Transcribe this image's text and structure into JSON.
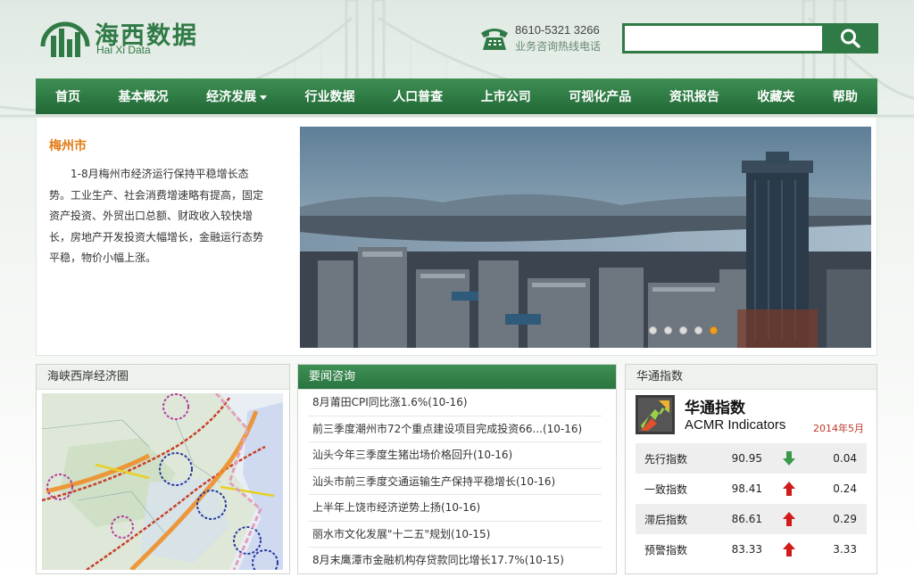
{
  "brand": {
    "name_cn": "海西数据",
    "name_en": "Hai Xi Data"
  },
  "hotline": {
    "number": "8610-5321 3266",
    "label": "业务咨询热线电话"
  },
  "search": {
    "placeholder": "",
    "button_icon": "search-icon"
  },
  "nav": [
    {
      "label": "首页"
    },
    {
      "label": "基本概况"
    },
    {
      "label": "经济发展",
      "dropdown": true
    },
    {
      "label": "行业数据"
    },
    {
      "label": "人口普查"
    },
    {
      "label": "上市公司"
    },
    {
      "label": "可视化产品"
    },
    {
      "label": "资讯报告"
    },
    {
      "label": "收藏夹"
    },
    {
      "label": "帮助"
    }
  ],
  "feature": {
    "title": "梅州市",
    "description": "1-8月梅州市经济运行保持平稳增长态势。工业生产、社会消费增速略有提高，固定资产投资、外贸出口总额、财政收入较快增长，房地产开发投资大幅增长，金融运行态势平稳，物价小幅上涨。",
    "slides": 5,
    "active_slide": 5
  },
  "map_panel": {
    "title": "海峡西岸经济圈"
  },
  "news_panel": {
    "title": "要闻咨询",
    "items": [
      "8月莆田CPI同比涨1.6%(10-16)",
      "前三季度潮州市72个重点建设项目完成投资66...(10-16)",
      "汕头今年三季度生猪出场价格回升(10-16)",
      "汕头市前三季度交通运输生产保持平稳增长(10-16)",
      "上半年上饶市经济逆势上扬(10-16)",
      "丽水市文化发展\"十二五\"规划(10-15)",
      "8月末鹰潭市金融机构存贷款同比增长17.7%(10-15)"
    ]
  },
  "index_panel": {
    "title": "华通指数",
    "heading_cn": "华通指数",
    "heading_en": "ACMR Indicators",
    "date": "2014年5月",
    "rows": [
      {
        "name": "先行指数",
        "value": "90.95",
        "trend": "down",
        "change": "0.04"
      },
      {
        "name": "一致指数",
        "value": "98.41",
        "trend": "up",
        "change": "0.24"
      },
      {
        "name": "滞后指数",
        "value": "86.61",
        "trend": "up",
        "change": "0.29"
      },
      {
        "name": "预警指数",
        "value": "83.33",
        "trend": "up",
        "change": "3.33"
      }
    ],
    "colors": {
      "up": "#d11a1a",
      "down": "#3a9a4a"
    }
  }
}
